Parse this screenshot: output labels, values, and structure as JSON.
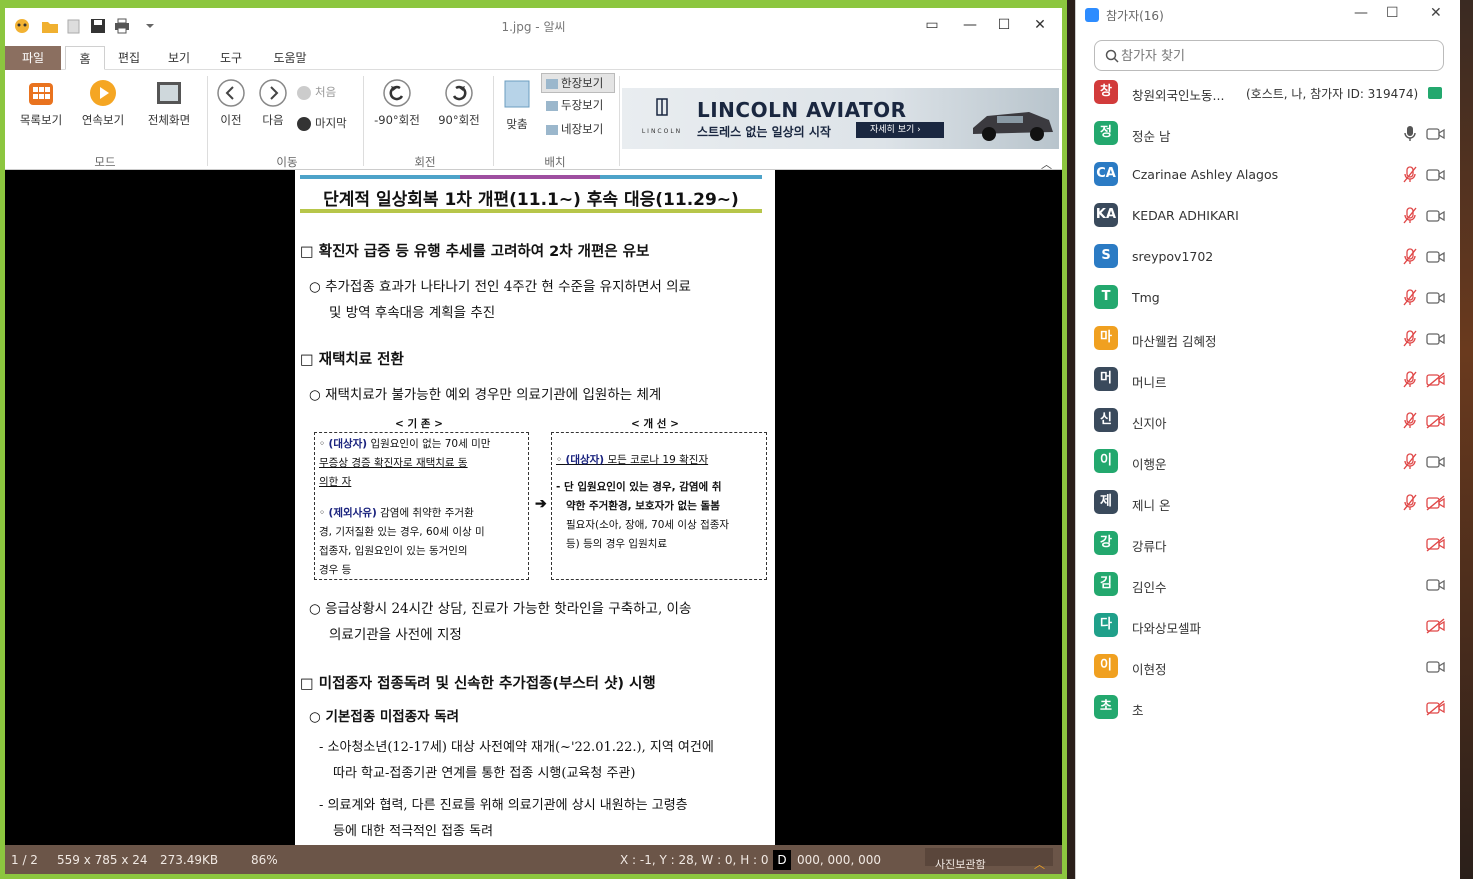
{
  "viewer": {
    "title": "1.jpg - 알씨",
    "menu_tabs": [
      "파일",
      "홈",
      "편집",
      "보기",
      "도구",
      "도움말"
    ],
    "ribbon": {
      "mode": {
        "label": "모드",
        "buttons": [
          "목록보기",
          "연속보기",
          "전체화면"
        ]
      },
      "move": {
        "label": "이동",
        "prev": "이전",
        "next": "다음",
        "first": "처음",
        "last": "마지막"
      },
      "rotate": {
        "label": "회전",
        "ccw": "-90°회전",
        "cw": "90°회전"
      },
      "layout": {
        "label": "배치",
        "fit": "맞춤",
        "single": "한장보기",
        "double": "두장보기",
        "quad": "네장보기"
      }
    },
    "ad": {
      "brand": "LINCOLN",
      "headline": "LINCOLN AVIATOR",
      "subline": "스트레스 없는 일상의 시작",
      "cta": "자세히 보기"
    },
    "document": {
      "title": "단계적 일상회복 1차 개편(11.1~) 후속 대응(11.29~)",
      "sec1": "□ 확진자 급증 등 유행 추세를 고려하여 2차 개편은 유보",
      "sec1_p1a": "○ 추가접종 효과가 나타나기 전인 4주간 현 수준을 유지하면서 의료",
      "sec1_p1b": "및 방역 후속대응 계획을 추진",
      "sec2": "□ 재택치료 전환",
      "sec2_p1": "○ 재택치료가 불가능한 예외 경우만 의료기관에 입원하는 체계",
      "box_left_hdr": "< 기 존 >",
      "box_right_hdr": "< 개 선 >",
      "box_left_1a": "(대상자)",
      "box_left_1b": " 입원요인이 없는 70세 미만",
      "box_left_1c": "무증상 경증 확진자로 재택치료 동",
      "box_left_1d": "의한 자",
      "box_left_2a": "(제외사유)",
      "box_left_2b": " 감염에 취약한 주거환",
      "box_left_2c": "경, 기저질환 있는 경우, 60세 이상 미",
      "box_left_2d": "접종자, 입원요인이 있는 동거인의",
      "box_left_2e": "경우 등",
      "box_right_1a": "(대상자)",
      "box_right_1b": " 모든 코로나 19 확진자",
      "box_right_2a": "- 단 입원요인이 있는 경우, 감염에 취",
      "box_right_2b": "약한 주거환경, 보호자가 없는 돌봄",
      "box_right_2c": "필요자(소아, 장애, 70세 이상 접종자",
      "box_right_2d": "등) 등의 경우 입원치료",
      "sec2_p2a": "○ 응급상황시 24시간 상담, 진료가 가능한 핫라인을 구축하고, 이송",
      "sec2_p2b": "의료기관을 사전에 지정",
      "sec3": "□ 미접종자 접종독려 및 신속한 추가접종(부스터 샷) 시행",
      "sec3_p1": "○ 기본접종 미접종자 독려",
      "sec3_p2a": "- 소아청소년(12-17세) 대상 사전예약 재개(~'22.01.22.), 지역 여건에",
      "sec3_p2b": "따라 학교-접종기관 연계를 통한 접종 시행(교육청 주관)",
      "sec3_p3a": "- 의료계와 협력, 다른 진료를 위해 의료기관에 상시 내원하는 고령층",
      "sec3_p3b": "등에 대한 적극적인 접종 독려"
    },
    "status": {
      "page": "1 / 2",
      "dimensions": "559 x 785 x 24",
      "size": "273.49KB",
      "zoom": "86%",
      "coords": "X : -1, Y : 28, W : 0, H : 0",
      "d": "D",
      "rgb": "000, 000, 000",
      "album": "사진보관함"
    }
  },
  "participants": {
    "title": "참가자(16)",
    "search_placeholder": "참가자 찾기",
    "list": [
      {
        "initial": "창",
        "color": "#d23b3b",
        "name": "창원외국인노동...",
        "extra": "(호스트, 나, 참가자 ID: 319474)",
        "mic": "none",
        "cam": "host"
      },
      {
        "initial": "정",
        "color": "#23a86e",
        "name": "정순 남",
        "extra": "",
        "mic": "on",
        "cam": "on"
      },
      {
        "initial": "CA",
        "color": "#2b7bc4",
        "name": "Czarinae Ashley Alagos",
        "extra": "",
        "mic": "muted",
        "cam": "on"
      },
      {
        "initial": "KA",
        "color": "#3a4a5c",
        "name": "KEDAR ADHIKARI",
        "extra": "",
        "mic": "muted",
        "cam": "on"
      },
      {
        "initial": "S",
        "color": "#2b7bc4",
        "name": "sreypov1702",
        "extra": "",
        "mic": "muted",
        "cam": "on"
      },
      {
        "initial": "T",
        "color": "#23a86e",
        "name": "Tmg",
        "extra": "",
        "mic": "muted",
        "cam": "on"
      },
      {
        "initial": "마",
        "color": "#f0a020",
        "name": "마산웰컴 김혜정",
        "extra": "",
        "mic": "muted",
        "cam": "on"
      },
      {
        "initial": "머",
        "color": "#3a4a5c",
        "name": "머니르",
        "extra": "",
        "mic": "muted",
        "cam": "off"
      },
      {
        "initial": "신",
        "color": "#3a4a5c",
        "name": "신지아",
        "extra": "",
        "mic": "muted",
        "cam": "off"
      },
      {
        "initial": "이",
        "color": "#23a86e",
        "name": "이행운",
        "extra": "",
        "mic": "muted",
        "cam": "on"
      },
      {
        "initial": "제",
        "color": "#3a4a5c",
        "name": "제니 온",
        "extra": "",
        "mic": "muted",
        "cam": "off"
      },
      {
        "initial": "강",
        "color": "#23a86e",
        "name": "강류다",
        "extra": "",
        "mic": "none",
        "cam": "off"
      },
      {
        "initial": "김",
        "color": "#23a86e",
        "name": "김인수",
        "extra": "",
        "mic": "none",
        "cam": "on"
      },
      {
        "initial": "다",
        "color": "#1fa08a",
        "name": "다와상모셀파",
        "extra": "",
        "mic": "none",
        "cam": "off"
      },
      {
        "initial": "이",
        "color": "#f0a020",
        "name": "이현정",
        "extra": "",
        "mic": "none",
        "cam": "on"
      },
      {
        "initial": "초",
        "color": "#23a86e",
        "name": "초",
        "extra": "",
        "mic": "none",
        "cam": "off"
      }
    ]
  }
}
